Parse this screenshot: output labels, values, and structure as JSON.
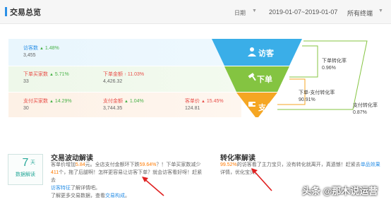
{
  "header": {
    "title": "交易总览",
    "date_label": "日期",
    "date_caret": "▼",
    "date_range": "2019-01-07~2019-01-07",
    "terminal": "所有终端",
    "terminal_caret": "▼"
  },
  "metrics": {
    "visitors": {
      "label": "访客数",
      "arrow": "▲",
      "pct": "1.48%",
      "value": "3,455"
    },
    "order_buyers": {
      "label": "下单买家数",
      "arrow": "▲",
      "pct": "5.71%",
      "value": "33"
    },
    "order_amount": {
      "label": "下单金额",
      "arrow": "↑",
      "pct": "11.03%",
      "value": "4,426.32"
    },
    "pay_buyers": {
      "label": "支付买家数",
      "arrow": "▲",
      "pct": "14.29%",
      "value": "30"
    },
    "pay_amount": {
      "label": "支付金额",
      "arrow": "▲",
      "pct": "1.04%",
      "value": "3,744.35"
    },
    "unit_price": {
      "label": "客单价",
      "arrow": "▲",
      "pct": "15.45%",
      "value": "124.81"
    }
  },
  "funnel": {
    "stage1": "访客",
    "stage2": "下单",
    "stage3": "支付",
    "colors": {
      "visitor": "#3aaee8",
      "order": "#84c441",
      "pay": "#f5a623"
    }
  },
  "rates": {
    "order_rate": {
      "label": "下单转化率",
      "value": "0.96%"
    },
    "order_pay_rate": {
      "label": "下单-支付转化率",
      "value": "90.91%"
    },
    "pay_rate": {
      "label": "支付转化率",
      "value": "0.87%"
    }
  },
  "analysis": {
    "days_num": "7",
    "days_unit": "天",
    "days_label": "数据解读",
    "trade_title": "交易波动解读",
    "trade_l1a": "客单价增加",
    "trade_l1b": "5.84",
    "trade_l1c": "元。全店支付金额环下跌",
    "trade_l1d": "59.64%",
    "trade_l1e": "？！下单买家数减少",
    "trade_l2a": "411",
    "trade_l2b": "个，拖了后腿啊！怎样更容易让访客下单？就会访客看好呀！赶紧去",
    "trade_l3a": "访客特征",
    "trade_l3b": "了解详情吧。",
    "trade_l4a": "了解更多交易数据，查看",
    "trade_l4b": "交易构成",
    "trade_l4c": "。",
    "conv_title": "转化率解读",
    "conv_l1a": "99.52%",
    "conv_l1b": "的访客看了主力宝贝，没有转化就离开，真遗憾！赶紧去",
    "conv_l1c": "单品效果",
    "conv_l2": "详情，优化宝贝。"
  },
  "watermark": "头条 @那木说运营"
}
